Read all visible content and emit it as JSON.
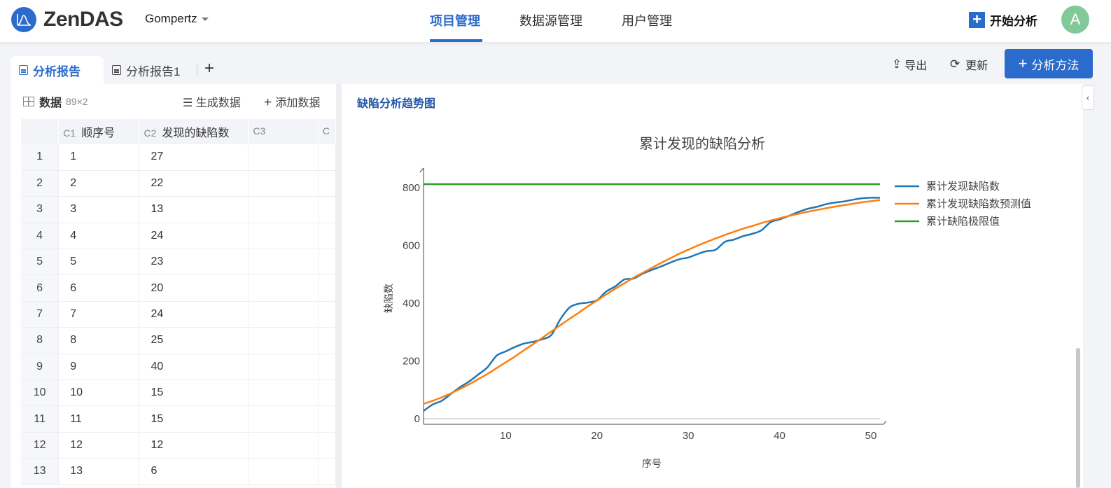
{
  "header": {
    "brand": "ZenDAS",
    "project": "Gompertz",
    "nav": [
      "项目管理",
      "数据源管理",
      "用户管理"
    ],
    "active_nav": 0,
    "start_label": "开始分析",
    "avatar": "A"
  },
  "tabs": {
    "items": [
      "分析报告",
      "分析报告1"
    ],
    "active": 0,
    "add": "+"
  },
  "toolbar": {
    "export": "导出",
    "refresh": "更新",
    "method": "分析方法"
  },
  "data_panel": {
    "title": "数据",
    "dims": "89×2",
    "generate": "生成数据",
    "add": "添加数据",
    "columns": [
      {
        "id": "C1",
        "name": "顺序号"
      },
      {
        "id": "C2",
        "name": "发现的缺陷数"
      },
      {
        "id": "C3",
        "name": ""
      },
      {
        "id": "C",
        "name": ""
      }
    ],
    "rows": [
      [
        "1",
        "1",
        "27"
      ],
      [
        "2",
        "2",
        "22"
      ],
      [
        "3",
        "3",
        "13"
      ],
      [
        "4",
        "4",
        "24"
      ],
      [
        "5",
        "5",
        "23"
      ],
      [
        "6",
        "6",
        "20"
      ],
      [
        "7",
        "7",
        "24"
      ],
      [
        "8",
        "8",
        "25"
      ],
      [
        "9",
        "9",
        "40"
      ],
      [
        "10",
        "10",
        "15"
      ],
      [
        "11",
        "11",
        "15"
      ],
      [
        "12",
        "12",
        "12"
      ],
      [
        "13",
        "13",
        "6"
      ]
    ]
  },
  "chart_panel": {
    "title": "缺陷分析趋势图"
  },
  "chart_data": {
    "type": "line",
    "title": "累计发现的缺陷分析",
    "xlabel": "序号",
    "ylabel": "缺陷数",
    "xlim": [
      1,
      51
    ],
    "ylim": [
      -10,
      830
    ],
    "xticks": [
      10,
      20,
      30,
      40,
      50
    ],
    "yticks": [
      0,
      200,
      400,
      600,
      800
    ],
    "legend": "right",
    "grid": false,
    "x": [
      1,
      2,
      3,
      4,
      5,
      6,
      7,
      8,
      9,
      10,
      11,
      12,
      13,
      14,
      15,
      16,
      17,
      18,
      19,
      20,
      21,
      22,
      23,
      24,
      25,
      26,
      27,
      28,
      29,
      30,
      31,
      32,
      33,
      34,
      35,
      36,
      37,
      38,
      39,
      40,
      41,
      42,
      43,
      44,
      45,
      46,
      47,
      48,
      49,
      50,
      51
    ],
    "series": [
      {
        "name": "累计发现缺陷数",
        "color": "#1f77b4",
        "values": [
          27,
          49,
          62,
          86,
          109,
          129,
          153,
          178,
          218,
          233,
          248,
          260,
          266,
          275,
          290,
          345,
          385,
          398,
          402,
          410,
          440,
          458,
          482,
          485,
          502,
          515,
          527,
          540,
          552,
          558,
          570,
          580,
          585,
          612,
          620,
          632,
          640,
          652,
          680,
          690,
          702,
          715,
          726,
          733,
          742,
          748,
          752,
          758,
          763,
          765,
          765
        ]
      },
      {
        "name": "累计发现缺陷数预测值",
        "color": "#ff7f0e",
        "values": [
          51,
          62,
          74,
          88,
          103,
          119,
          137,
          155,
          175,
          195,
          215,
          237,
          258,
          280,
          302,
          324,
          346,
          367,
          389,
          409,
          430,
          450,
          469,
          488,
          505,
          522,
          539,
          555,
          571,
          585,
          599,
          612,
          624,
          636,
          647,
          658,
          667,
          677,
          686,
          694,
          702,
          709,
          716,
          722,
          728,
          734,
          739,
          744,
          749,
          753,
          757
        ]
      },
      {
        "name": "累计缺陷极限值",
        "color": "#2ca02c",
        "values": [
          812,
          812,
          812,
          812,
          812,
          812,
          812,
          812,
          812,
          812,
          812,
          812,
          812,
          812,
          812,
          812,
          812,
          812,
          812,
          812,
          812,
          812,
          812,
          812,
          812,
          812,
          812,
          812,
          812,
          812,
          812,
          812,
          812,
          812,
          812,
          812,
          812,
          812,
          812,
          812,
          812,
          812,
          812,
          812,
          812,
          812,
          812,
          812,
          812,
          812,
          812
        ]
      }
    ]
  }
}
